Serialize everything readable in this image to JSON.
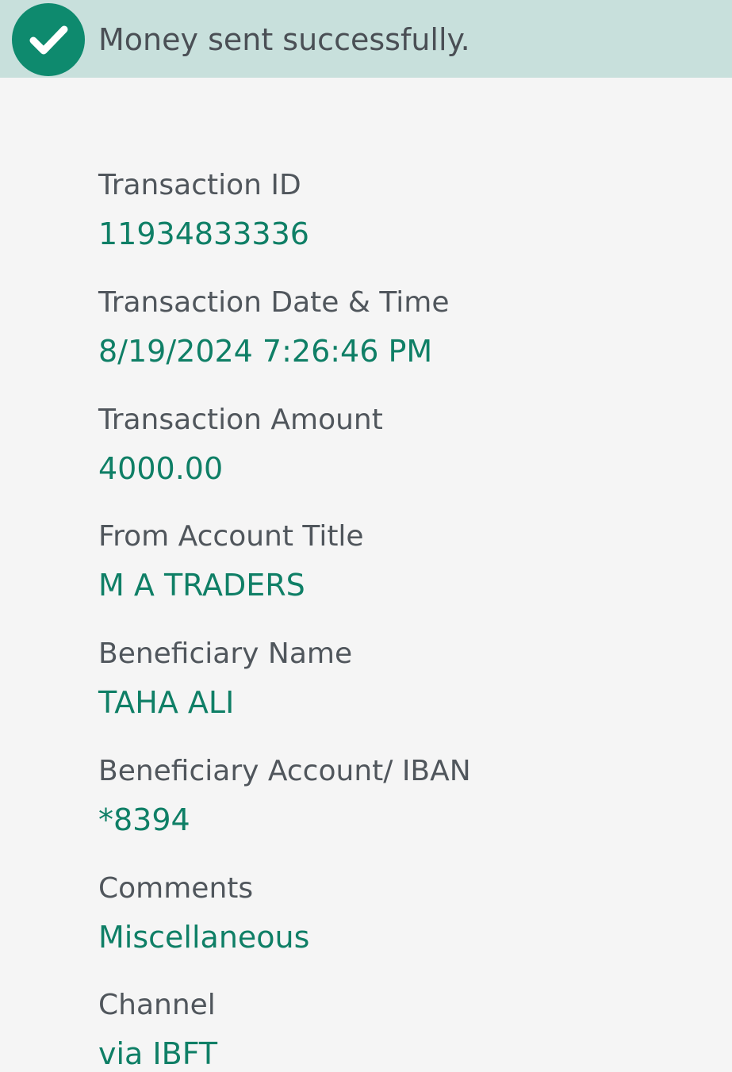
{
  "banner": {
    "icon": "check-circle-icon",
    "message": "Money sent successfully.",
    "accent_color": "#0e8a6e",
    "background_color": "#c8e0dc"
  },
  "fields": [
    {
      "label": "Transaction ID",
      "value": "11934833336"
    },
    {
      "label": "Transaction Date & Time",
      "value": "8/19/2024 7:26:46 PM"
    },
    {
      "label": "Transaction Amount",
      "value": "4000.00"
    },
    {
      "label": "From Account Title",
      "value": "M A TRADERS"
    },
    {
      "label": "Beneficiary Name",
      "value": "TAHA ALI"
    },
    {
      "label": "Beneficiary Account/ IBAN",
      "value": "*8394"
    },
    {
      "label": "Comments",
      "value": "Miscellaneous"
    },
    {
      "label": "Channel",
      "value": "via IBFT"
    }
  ],
  "colors": {
    "label": "#50565c",
    "value": "#0f7f66",
    "page_background": "#f5f5f5"
  }
}
